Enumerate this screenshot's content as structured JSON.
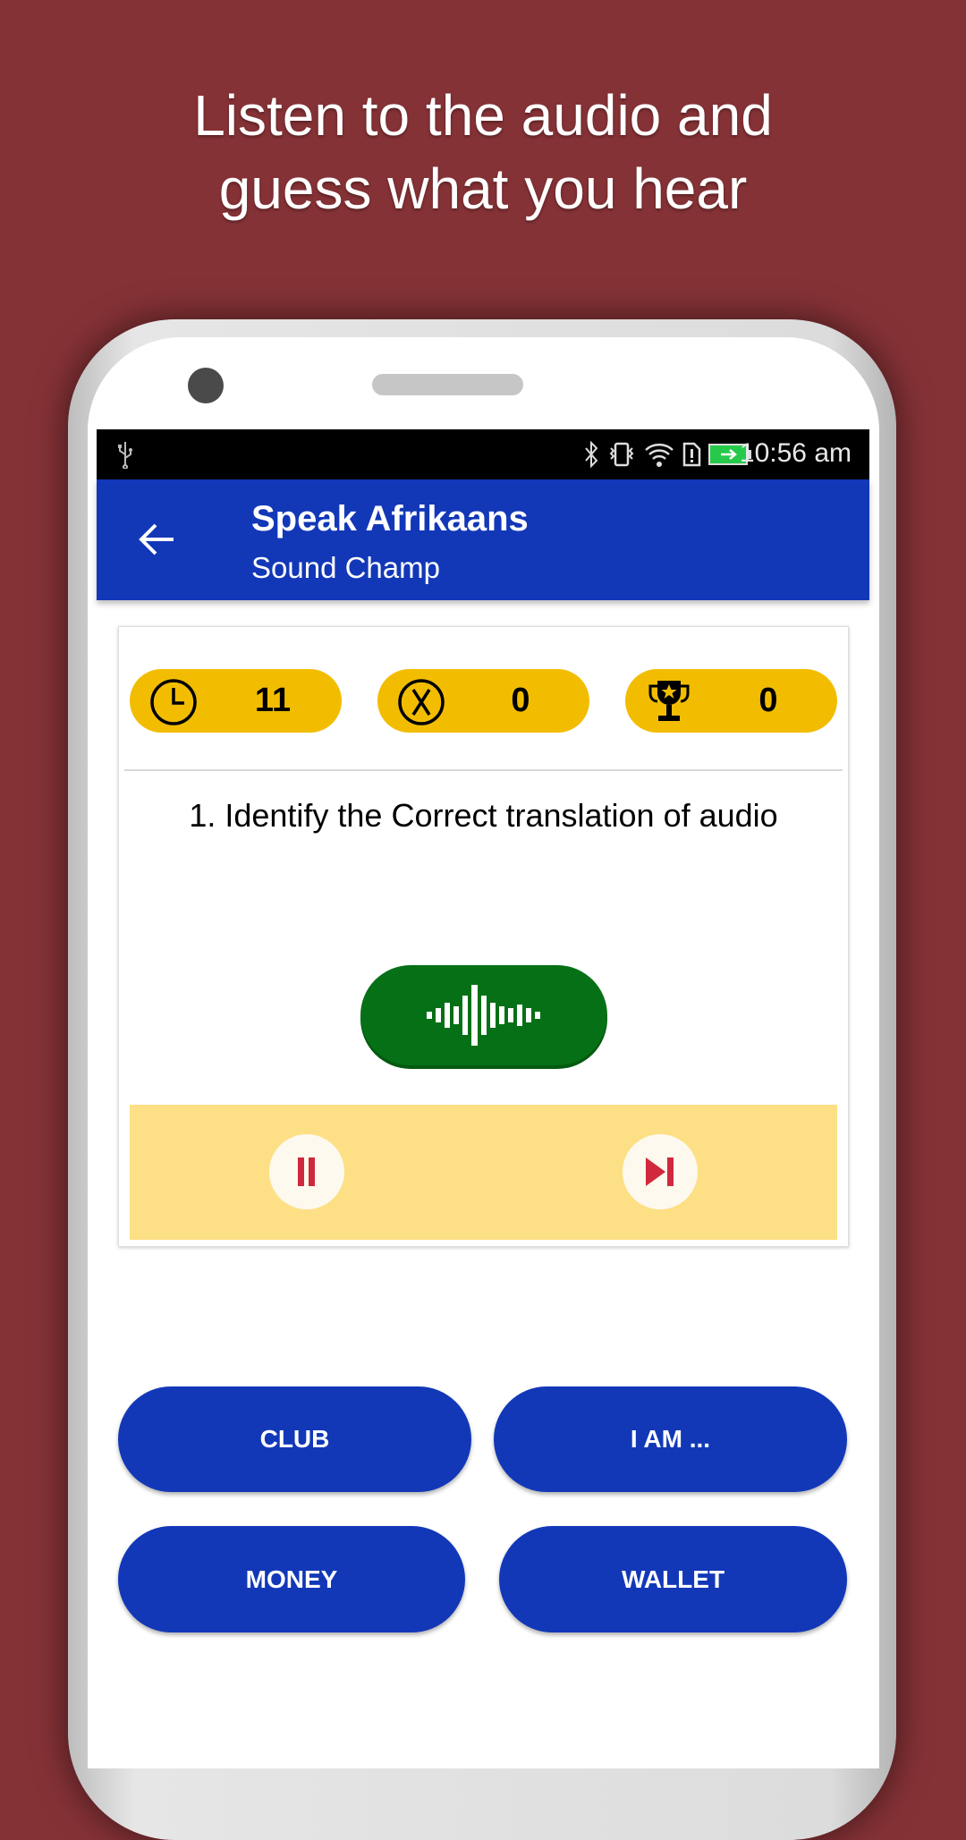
{
  "promo": {
    "headline_line1": "Listen to the audio and",
    "headline_line2": "guess what you hear"
  },
  "status_bar": {
    "time": "10:56 am",
    "icons": [
      "usb-icon",
      "bluetooth-icon",
      "vibrate-icon",
      "wifi-icon",
      "sim-alert-icon",
      "battery-charging-icon"
    ]
  },
  "app_bar": {
    "title": "Speak Afrikaans",
    "subtitle": "Sound Champ",
    "back_icon": "arrow-left-icon"
  },
  "stats": {
    "timer": {
      "icon": "clock-icon",
      "value": "11"
    },
    "wrong": {
      "icon": "x-circle-icon",
      "value": "0"
    },
    "score": {
      "icon": "trophy-icon",
      "value": "0"
    }
  },
  "question": {
    "text": "1. Identify the Correct translation of  audio"
  },
  "audio": {
    "icon": "sound-wave-icon"
  },
  "controls": {
    "pause_icon": "pause-icon",
    "next_icon": "skip-next-icon"
  },
  "answers": [
    {
      "label": "CLUB"
    },
    {
      "label": "I AM ..."
    },
    {
      "label": "MONEY"
    },
    {
      "label": "WALLET"
    }
  ],
  "colors": {
    "background": "#853236",
    "app_bar": "#1238b8",
    "pill": "#f2bd00",
    "audio_button": "#067016",
    "controls_bar": "#fde085",
    "control_icon": "#d0283c"
  }
}
